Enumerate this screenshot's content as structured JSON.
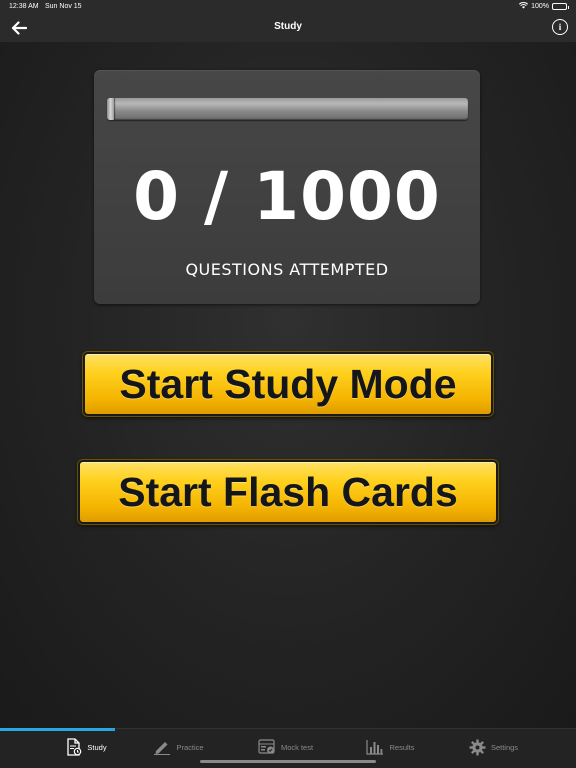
{
  "status_bar": {
    "time": "12:38 AM",
    "date": "Sun Nov 15",
    "battery": "100%"
  },
  "nav": {
    "title": "Study",
    "info_glyph": "i"
  },
  "progress": {
    "attempted": 0,
    "total": 1000,
    "fraction": 0.0
  },
  "stats": {
    "count_text": "0 / 1000",
    "label": "QUESTIONS ATTEMPTED"
  },
  "buttons": {
    "study_mode": "Start Study Mode",
    "flash_cards": "Start Flash Cards"
  },
  "tabs": [
    {
      "label": "Study",
      "icon": "document-icon",
      "active": true
    },
    {
      "label": "Practice",
      "icon": "pencil-icon",
      "active": false
    },
    {
      "label": "Mock test",
      "icon": "test-card-icon",
      "active": false
    },
    {
      "label": "Results",
      "icon": "bar-chart-icon",
      "active": false
    },
    {
      "label": "Settings",
      "icon": "gear-icon",
      "active": false
    }
  ],
  "colors": {
    "accent_yellow": "#f4b400",
    "tab_indicator": "#29a8e0",
    "background": "#1b1b1b"
  }
}
